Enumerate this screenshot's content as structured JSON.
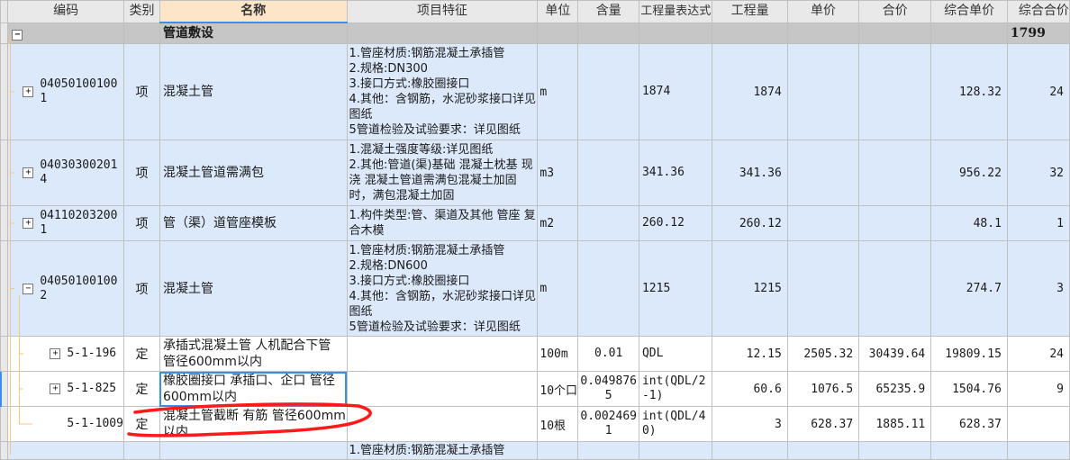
{
  "columns": {
    "code": "编码",
    "type": "类别",
    "name": "名称",
    "features": "项目特征",
    "unit": "单位",
    "content": "含量",
    "expr": "工程量表达式",
    "qty": "工程量",
    "price": "单价",
    "total": "合价",
    "comp_price": "综合单价",
    "comp_total": "综合合价"
  },
  "group": {
    "toggle": "−",
    "name": "管道敷设",
    "comp_total": "1799"
  },
  "rows": [
    {
      "toggle": "+",
      "code": "040501001001",
      "type": "项",
      "name": "混凝土管",
      "features": "1.管座材质:钢筋混凝土承插管\n2.规格:DN300\n3.接口方式:橡胶圈接口\n4.其他：含钢筋，水泥砂浆接口详见图纸\n5管道检验及试验要求：详见图纸",
      "unit": "m",
      "content": "",
      "expr": "1874",
      "qty": "1874",
      "price": "",
      "total": "",
      "comp_price": "128.32",
      "comp_total": "24"
    },
    {
      "toggle": "+",
      "code": "040303002014",
      "type": "项",
      "name": "混凝土管道需满包",
      "features": "1.混凝土强度等级:详见图纸\n2.其他:管道(渠)基础 混凝土枕基 现浇  混凝土管道需满包混凝土加固时，满包混凝土加固",
      "unit": "m3",
      "content": "",
      "expr": "341.36",
      "qty": "341.36",
      "price": "",
      "total": "",
      "comp_price": "956.22",
      "comp_total": "32"
    },
    {
      "toggle": "+",
      "code": "041102032001",
      "type": "项",
      "name": "管（渠）道管座模板",
      "features": "1.构件类型:管、渠道及其他 管座 复合木模",
      "unit": "m2",
      "content": "",
      "expr": "260.12",
      "qty": "260.12",
      "price": "",
      "total": "",
      "comp_price": "48.1",
      "comp_total": "1"
    },
    {
      "toggle": "−",
      "code": "040501001002",
      "type": "项",
      "name": "混凝土管",
      "features": "1.管座材质:钢筋混凝土承插管\n2.规格:DN600\n3.接口方式:橡胶圈接口\n4.其他：含钢筋，水泥砂浆接口详见图纸\n5管道检验及试验要求：详见图纸",
      "unit": "m",
      "content": "",
      "expr": "1215",
      "qty": "1215",
      "price": "",
      "total": "",
      "comp_price": "274.7",
      "comp_total": "3"
    },
    {
      "toggle": "+",
      "code": "5-1-196",
      "type": "定",
      "name": "承插式混凝土管 人机配合下管 管径600mm以内",
      "features": "",
      "unit": "100m",
      "content": "0.01",
      "expr": "QDL",
      "qty": "12.15",
      "price": "2505.32",
      "total": "30439.64",
      "comp_price": "19809.15",
      "comp_total": "24"
    },
    {
      "toggle": "+",
      "code": "5-1-825",
      "type": "定",
      "name": "橡胶圈接口 承插口、企口 管径600mm以内",
      "features": "",
      "unit": "10个口",
      "content": "0.0498765",
      "expr": "int(QDL/2-1)",
      "qty": "60.6",
      "price": "1076.5",
      "total": "65235.9",
      "comp_price": "1504.76",
      "comp_total": "9"
    },
    {
      "toggle": "",
      "code": "5-1-1009",
      "type": "定",
      "name": "混凝土管截断 有筋 管径600mm以内",
      "features": "",
      "unit": "10根",
      "content": "0.0024691",
      "expr": "int(QDL/40)",
      "qty": "3",
      "price": "628.37",
      "total": "1885.11",
      "comp_price": "628.37",
      "comp_total": ""
    },
    {
      "toggle": "",
      "code": "",
      "type": "",
      "name": "",
      "features": "1.管座材质:钢筋混凝土承插管",
      "unit": "",
      "content": "",
      "expr": "",
      "qty": "",
      "price": "",
      "total": "",
      "comp_price": "",
      "comp_total": ""
    }
  ],
  "annotation": {
    "color": "#ff1a1a",
    "target": "5-1-1009 name"
  }
}
